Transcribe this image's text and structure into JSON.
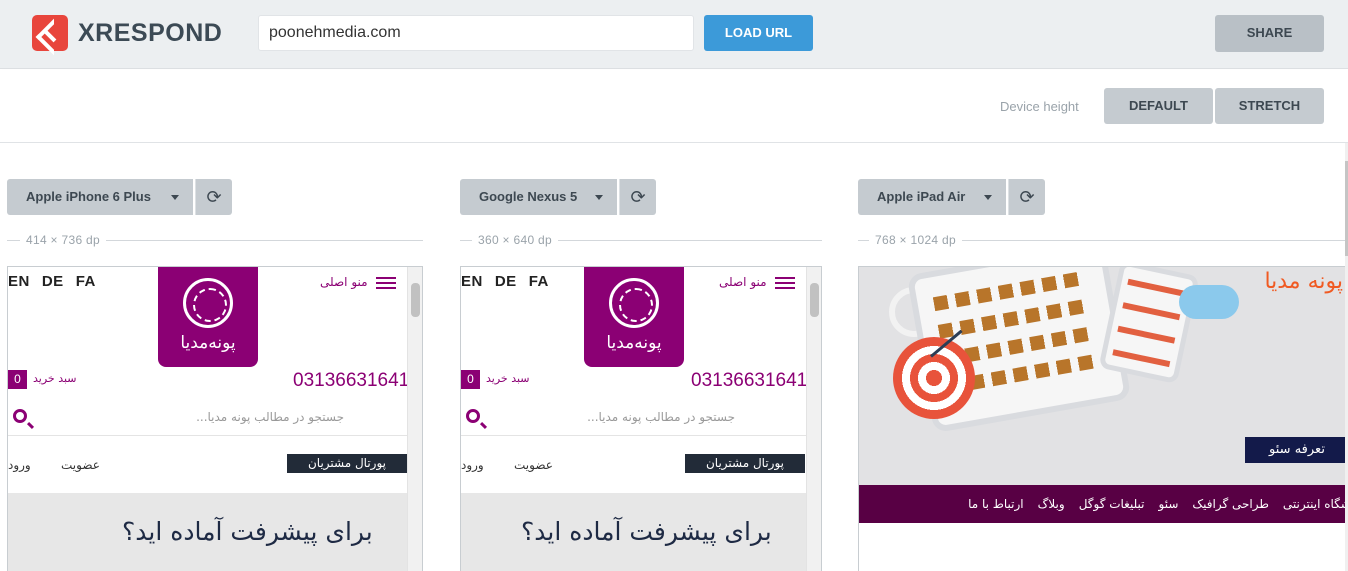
{
  "app": {
    "logo_text": "XRESPOND"
  },
  "toolbar": {
    "url_value": "poonehmedia.com",
    "load_label": "LOAD URL",
    "share_label": "SHARE"
  },
  "height_bar": {
    "label": "Device height",
    "default_label": "DEFAULT",
    "stretch_label": "STRETCH"
  },
  "devices": [
    {
      "name": "Apple iPhone 6 Plus",
      "dims": "414 × 736 dp"
    },
    {
      "name": "Google Nexus 5",
      "dims": "360 × 640 dp"
    },
    {
      "name": "Apple iPad Air",
      "dims": "768 × 1024 dp"
    }
  ],
  "site": {
    "langs": [
      "EN",
      "DE",
      "FA"
    ],
    "menu": "منو اصلی",
    "logo_text": "پونه‌مدیا",
    "cart_count": "0",
    "cart_label": "سبد خرید",
    "phone": "03136631641",
    "search_placeholder": "جستجو در مطالب پونه مدیا...",
    "portal": "پورتال مشتریان",
    "register": "عضویت",
    "login": "ورود",
    "hero_text": "برای پیشرفت آماده اید؟"
  },
  "ipad_site": {
    "title": "پونه مدیا",
    "badge": "تعرفه سئو",
    "nav": [
      "فروشگاه اینترنتی",
      "طراحی گرافیک",
      "سئو",
      "تبلیغات گوگل",
      "وبلاگ",
      "ارتباط با ما"
    ]
  },
  "colors": {
    "brand_purple": "#8b0074",
    "accent_blue": "#3c9ad9",
    "logo_red": "#e8453c"
  }
}
